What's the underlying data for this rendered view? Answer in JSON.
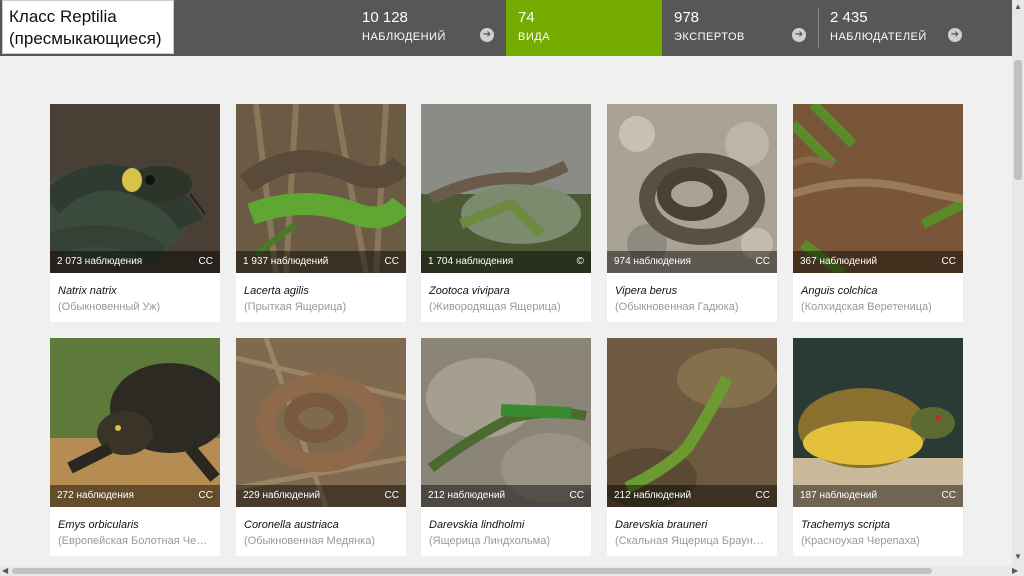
{
  "header": {
    "title_line1": "Класс Reptilia",
    "title_line2": "(пресмыкающиеся)",
    "stats": [
      {
        "number": "10 128",
        "label": "НАБЛЮДЕНИЙ",
        "active": false
      },
      {
        "number": "74",
        "label": "ВИДА",
        "active": true
      },
      {
        "number": "978",
        "label": "ЭКСПЕРТОВ",
        "active": false
      },
      {
        "number": "2 435",
        "label": "НАБЛЮДАТЕЛЕЙ",
        "active": false
      }
    ],
    "arrow_icon": "arrow-right-icon",
    "active_color": "#74ac00"
  },
  "species": [
    {
      "latin": "Natrix natrix",
      "common": "(Обыкновенный Уж)",
      "observations": "2 073 наблюдения",
      "license": "CC"
    },
    {
      "latin": "Lacerta agilis",
      "common": "(Прыткая Ящерица)",
      "observations": "1 937 наблюдений",
      "license": "CC"
    },
    {
      "latin": "Zootoca vivipara",
      "common": "(Живородящая Ящерица)",
      "observations": "1 704 наблюдения",
      "license": "©"
    },
    {
      "latin": "Vipera berus",
      "common": "(Обыкновенная Гадюка)",
      "observations": "974 наблюдения",
      "license": "CC"
    },
    {
      "latin": "Anguis colchica",
      "common": "(Колхидская Веретеница)",
      "observations": "367 наблюдений",
      "license": "CC"
    },
    {
      "latin": "Emys orbicularis",
      "common": "(Европейская Болотная Чер…",
      "observations": "272 наблюдения",
      "license": "CC"
    },
    {
      "latin": "Coronella austriaca",
      "common": "(Обыкновенная Медянка)",
      "observations": "229 наблюдений",
      "license": "CC"
    },
    {
      "latin": "Darevskia lindholmi",
      "common": "(Ящерица Линдхольма)",
      "observations": "212 наблюдений",
      "license": "CC"
    },
    {
      "latin": "Darevskia brauneri",
      "common": "(Скальная Ящерица Браунер…",
      "observations": "212 наблюдений",
      "license": "CC"
    },
    {
      "latin": "Trachemys scripta",
      "common": "(Красноухая Черепаха)",
      "observations": "187 наблюдений",
      "license": "CC"
    }
  ]
}
